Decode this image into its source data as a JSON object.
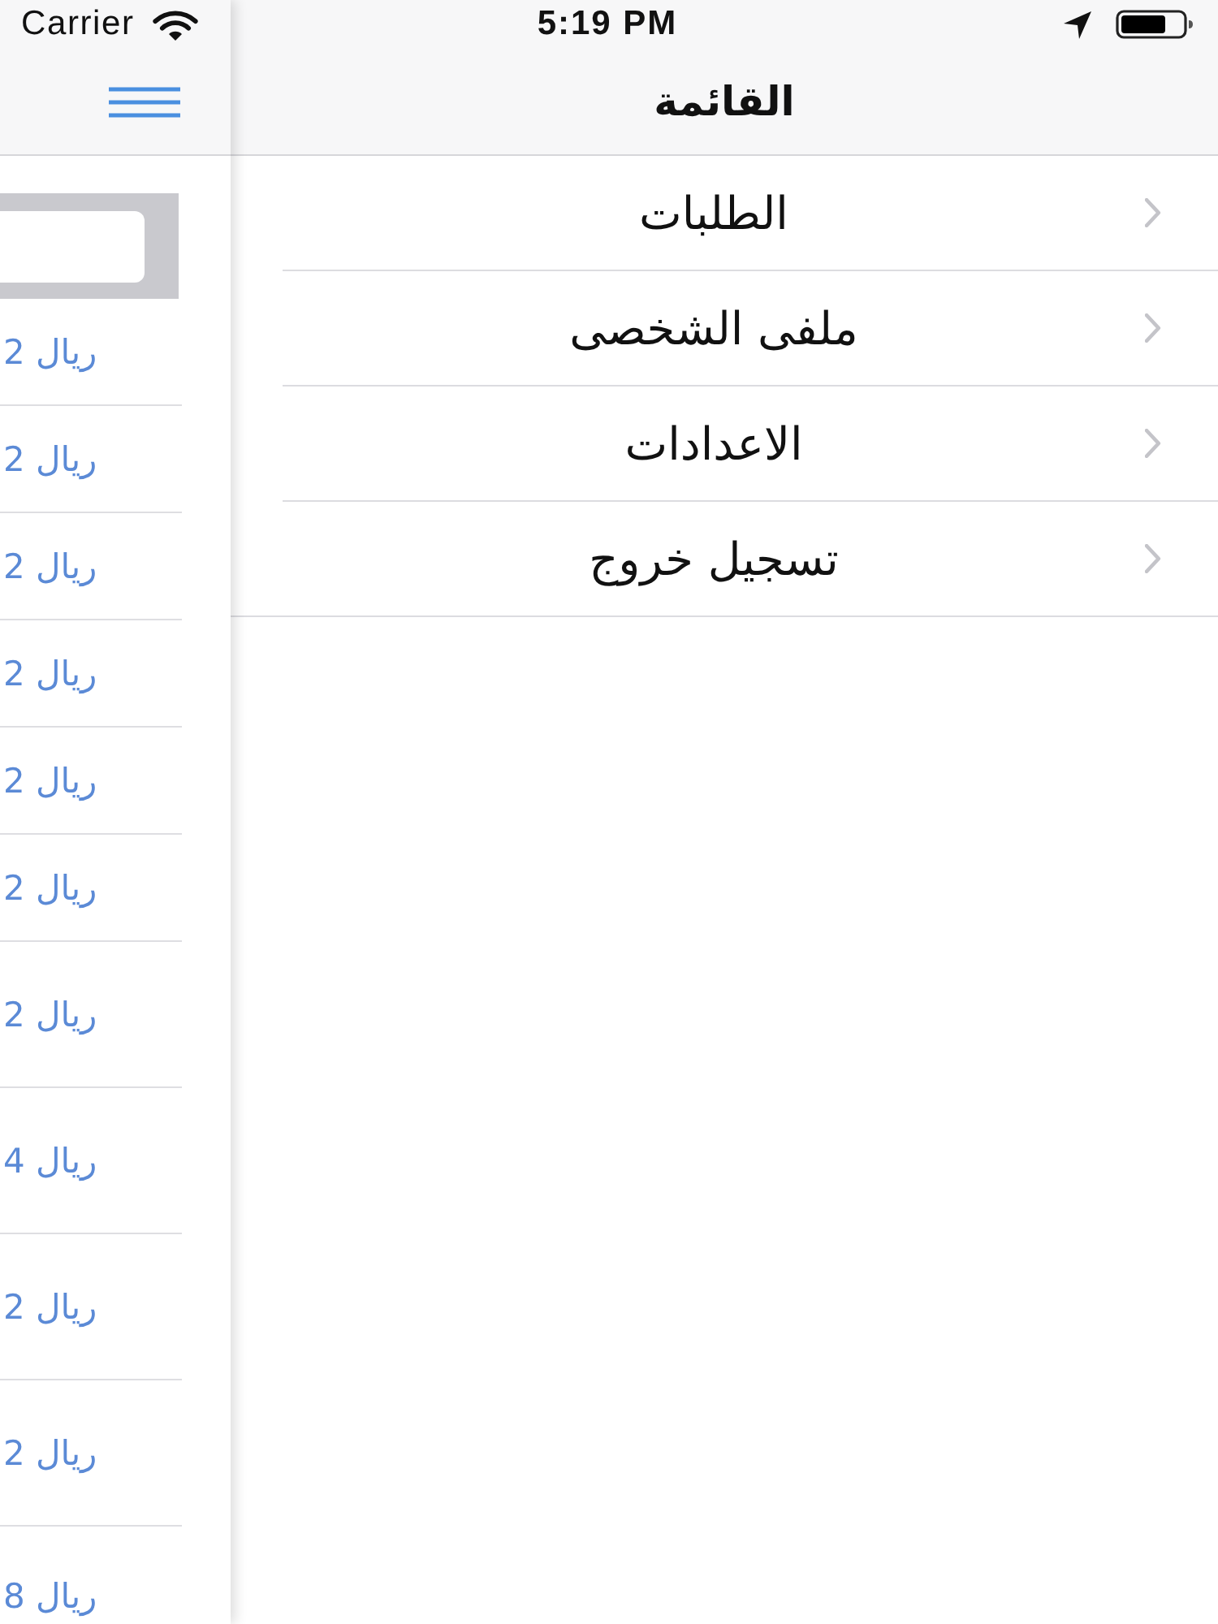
{
  "status_bar": {
    "carrier": "Carrier",
    "time": "5:19 PM"
  },
  "main_panel": {
    "prices": [
      "ريال 2",
      "ريال 2",
      "ريال 2",
      "ريال 2",
      "ريال 2",
      "ريال 2",
      "ريال 2",
      "ريال 4",
      "ريال 2",
      "ريال 2",
      "ريال 8"
    ]
  },
  "menu": {
    "title": "القائمة",
    "items": [
      {
        "label": "الطلبات"
      },
      {
        "label": "ملفى الشخصى"
      },
      {
        "label": "الاعدادات"
      },
      {
        "label": "تسجيل خروج"
      }
    ]
  }
}
